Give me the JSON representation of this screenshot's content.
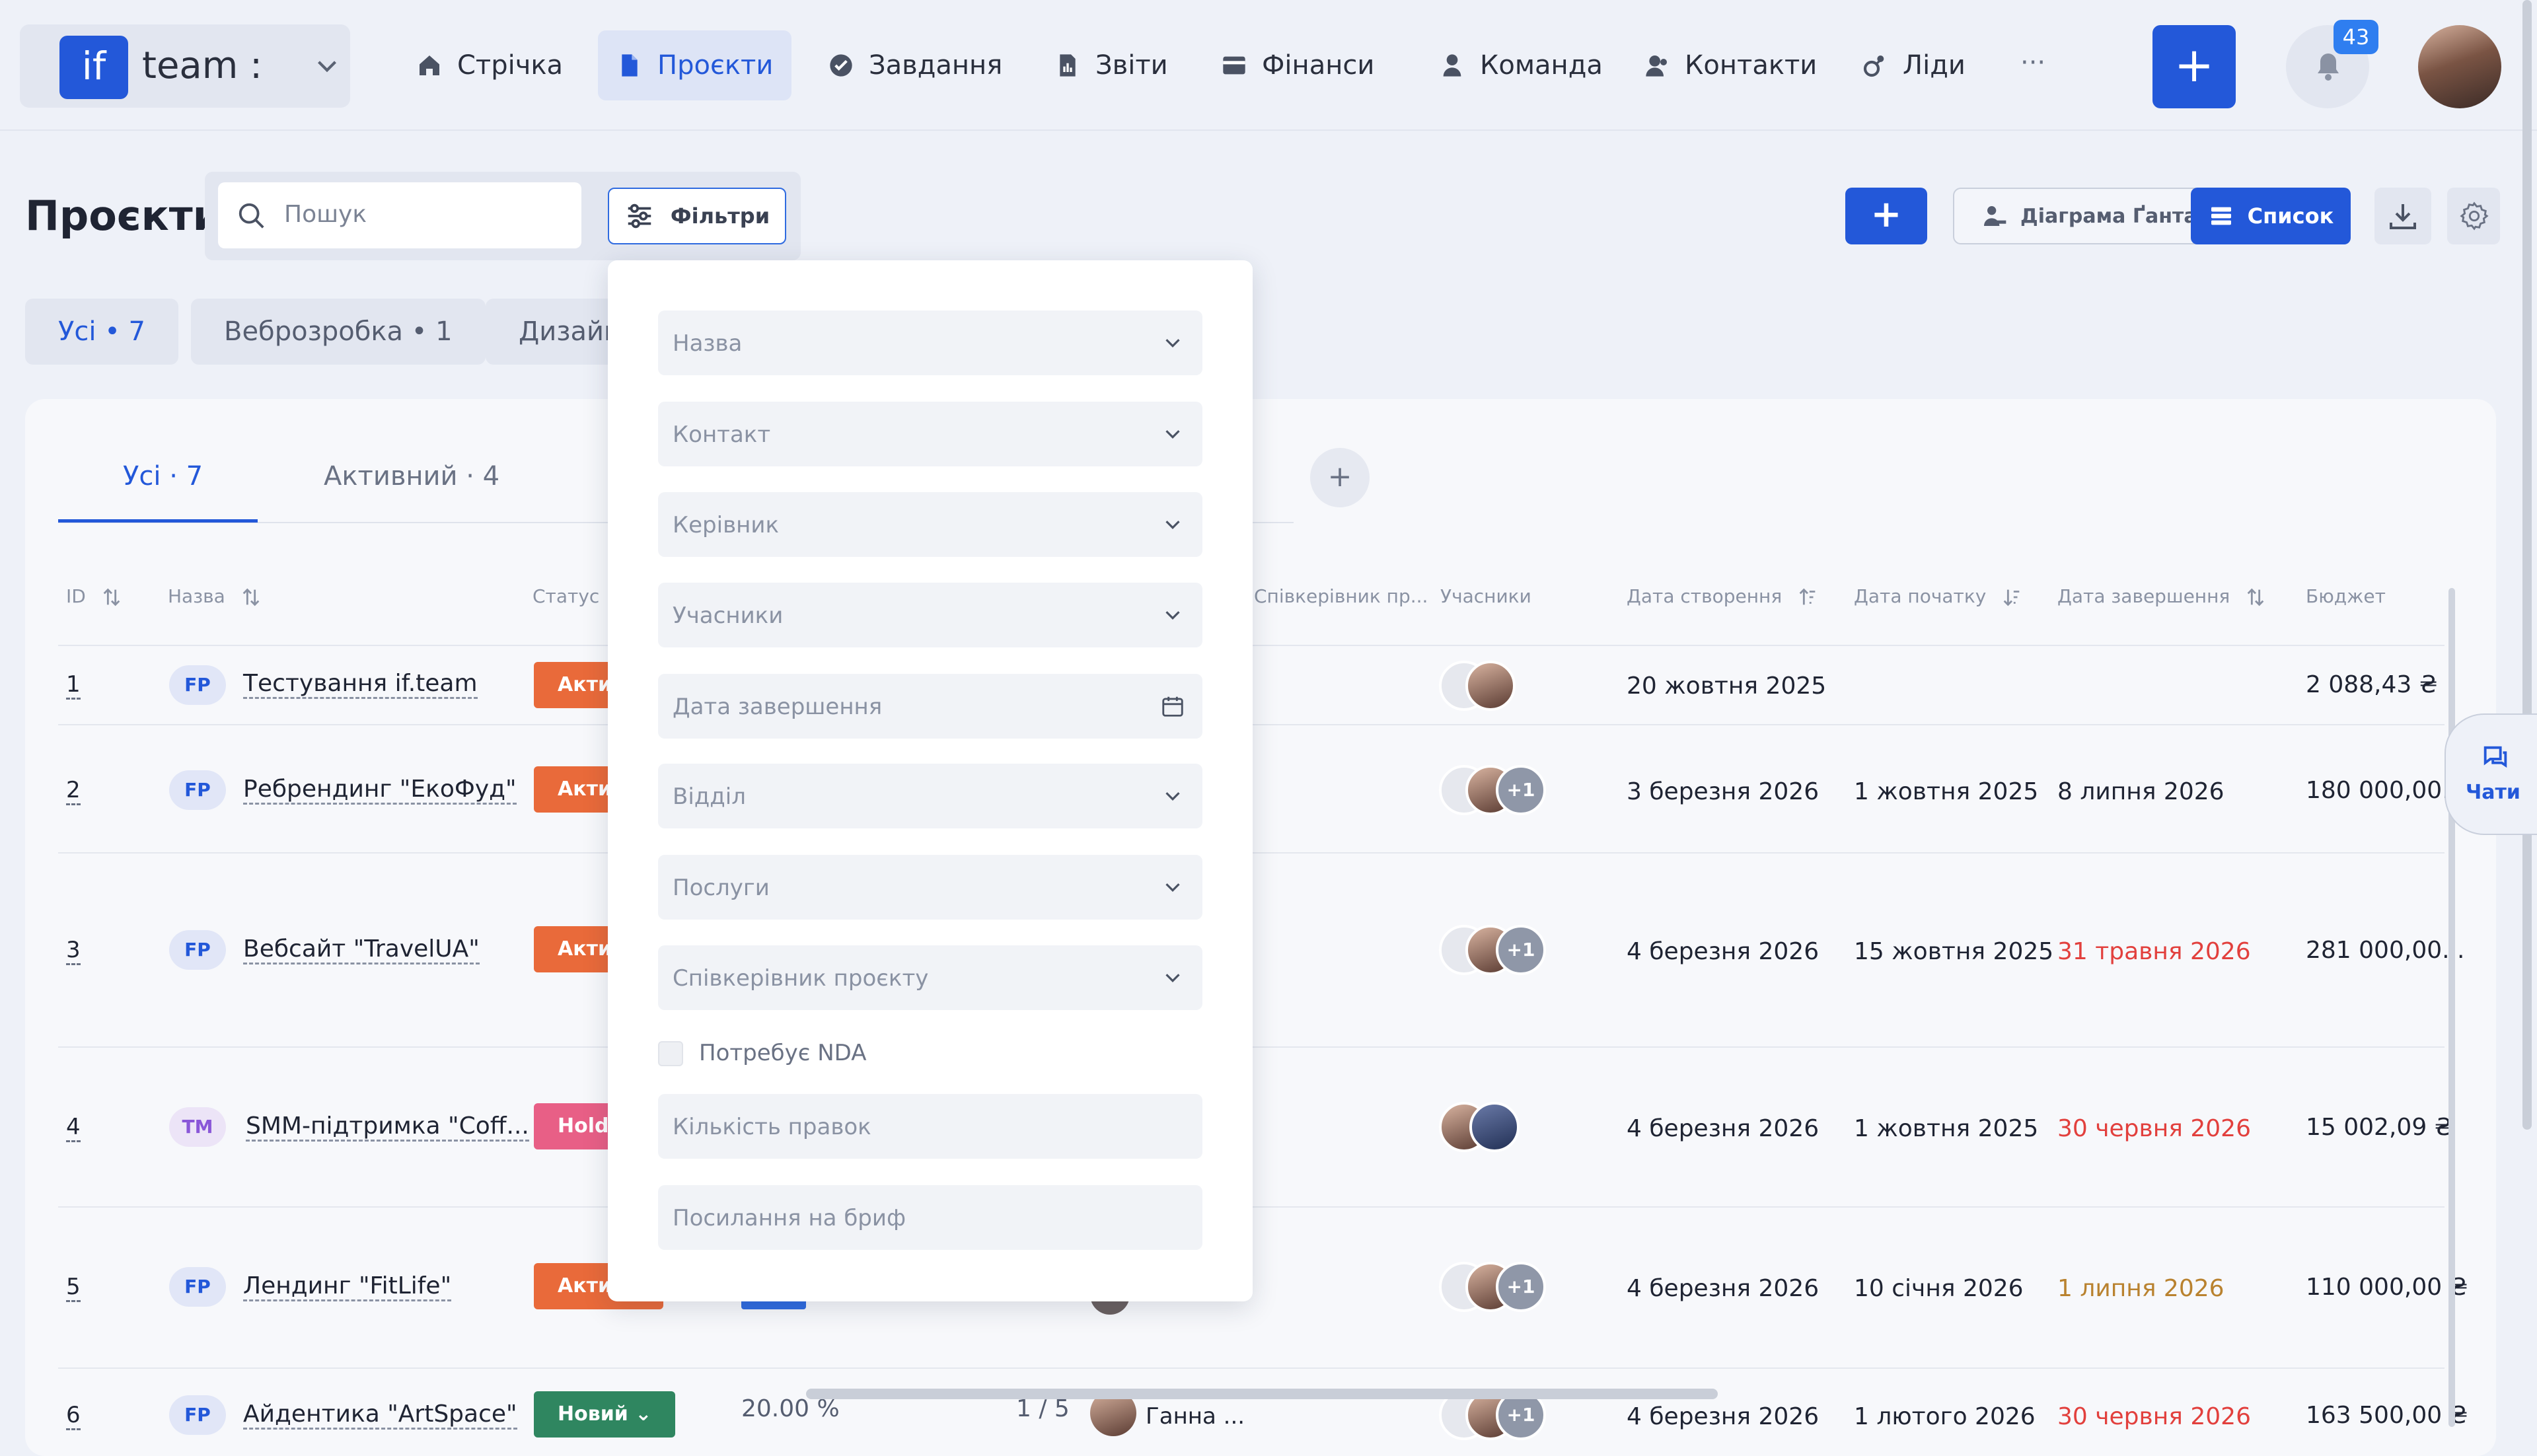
{
  "brand": {
    "logo_text": "if",
    "name": "team :"
  },
  "nav": [
    {
      "label": "Стрічка",
      "icon": "home-icon"
    },
    {
      "label": "Проєкти",
      "icon": "document-icon",
      "active": true
    },
    {
      "label": "Завдання",
      "icon": "check-circle-icon"
    },
    {
      "label": "Звіти",
      "icon": "report-icon"
    },
    {
      "label": "Фінанси",
      "icon": "wallet-icon"
    },
    {
      "label": "Команда",
      "icon": "person-icon"
    },
    {
      "label": "Контакти",
      "icon": "contacts-icon"
    },
    {
      "label": "Ліди",
      "icon": "leads-icon"
    }
  ],
  "nav_more": "···",
  "add_symbol": "+",
  "notifications": {
    "count": "43"
  },
  "page": {
    "title": "Проєкти"
  },
  "search": {
    "placeholder": "Пошук"
  },
  "filters_label": "Фільтри",
  "view": {
    "gantt_label": "Діаграма Ґанта",
    "list_label": "Список"
  },
  "chips": [
    {
      "label": "Усі • 7",
      "active": true
    },
    {
      "label": "Веброзробка • 1"
    },
    {
      "label": "Дизайн"
    }
  ],
  "tabs": [
    {
      "label": "Усі · 7",
      "active": true
    },
    {
      "label": "Активний · 4"
    }
  ],
  "columns": {
    "id": "ID",
    "name": "Назва",
    "status": "Статус",
    "coowner": "Співкерівник пр...",
    "members": "Учасники",
    "created": "Дата створення",
    "start": "Дата початку",
    "end": "Дата завершення",
    "budget": "Бюджет"
  },
  "rows": [
    {
      "id": "1",
      "type": "FP",
      "name": "Тестування if.team",
      "status": "Акти",
      "members_more": "",
      "created": "20 жовтня 2025",
      "start": "",
      "end": "",
      "end_color": "",
      "budget": "2 088,43 ₴"
    },
    {
      "id": "2",
      "type": "FP",
      "name": "Ребрендинг \"ЕкоФуд\"",
      "status": "Акти",
      "members_more": "+1",
      "created": "3 березня 2026",
      "start": "1 жовтня 2025",
      "end": "8 липня 2026",
      "end_color": "",
      "budget": "180 000,00..."
    },
    {
      "id": "3",
      "type": "FP",
      "name": "Вебсайт \"TravelUA\"",
      "status": "Акти",
      "members_more": "+1",
      "created": "4 березня 2026",
      "start": "15 жовтня 2025",
      "end": "31 травня 2026",
      "end_color": "red",
      "budget": "281 000,00..."
    },
    {
      "id": "4",
      "type": "TM",
      "name": "SMM-підтримка \"Coff...",
      "status": "Hold",
      "members_more": "",
      "created": "4 березня 2026",
      "start": "1 жовтня 2025",
      "end": "30 червня 2026",
      "end_color": "red",
      "budget": "15 002,09 ₴"
    },
    {
      "id": "5",
      "type": "FP",
      "name": "Лендинг \"FitLife\"",
      "status": "Акти",
      "members_more": "+1",
      "created": "4 березня 2026",
      "start": "10 січня 2026",
      "end": "1 липня 2026",
      "end_color": "amber",
      "budget": "110 000,00 ₴"
    },
    {
      "id": "6",
      "type": "FP",
      "name": "Айдентика \"ArtSpace\"",
      "status": "Новий ⌄",
      "members_more": "+1",
      "created": "4 березня 2026",
      "start": "1 лютого 2026",
      "end": "30 червня 2026",
      "end_color": "red",
      "budget": "163 500,00 ₴"
    }
  ],
  "row6_extra": {
    "progress": "20.00 %",
    "tasks": "1 / 5",
    "coowner": "Ганна ..."
  },
  "chats_label": "Чати",
  "filter_fields": [
    {
      "placeholder": "Назва",
      "kind": "select"
    },
    {
      "placeholder": "Контакт",
      "kind": "select"
    },
    {
      "placeholder": "Керівник",
      "kind": "select"
    },
    {
      "placeholder": "Учасники",
      "kind": "select"
    },
    {
      "placeholder": "Дата завершення",
      "kind": "date"
    },
    {
      "placeholder": "Відділ",
      "kind": "select"
    },
    {
      "placeholder": "Послуги",
      "kind": "select"
    },
    {
      "placeholder": "Співкерівник проєкту",
      "kind": "select"
    }
  ],
  "nda_label": "Потребує NDA",
  "filter_text_fields": [
    {
      "placeholder": "Кількість правок"
    },
    {
      "placeholder": "Посилання на бриф"
    }
  ]
}
